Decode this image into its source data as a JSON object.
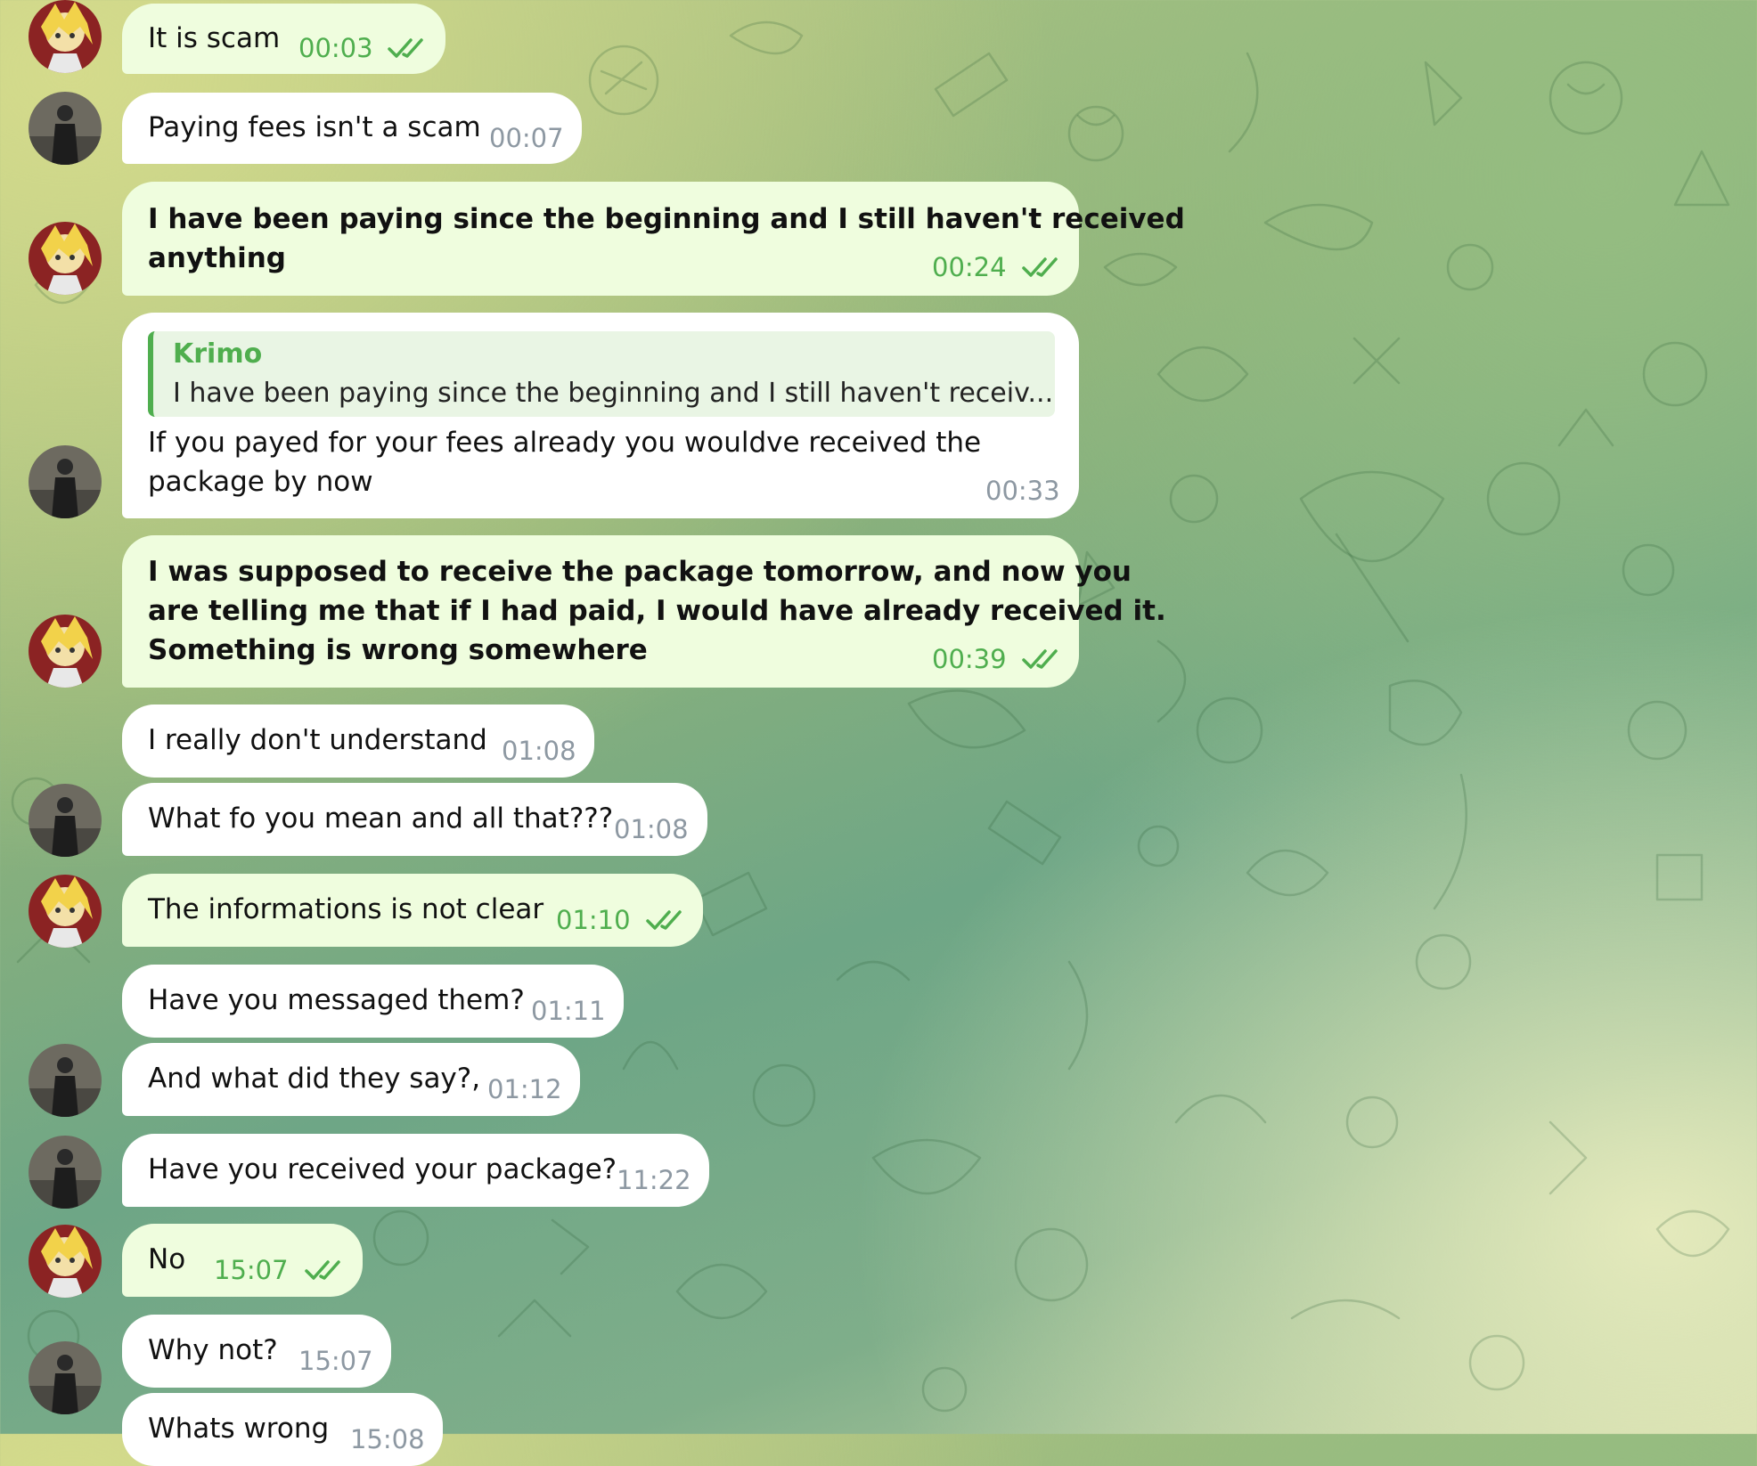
{
  "chat": {
    "messages": [
      {
        "sender": "me",
        "text": "It is scam",
        "time": "00:03",
        "status": "read"
      },
      {
        "sender": "them",
        "text": "Paying fees isn't a scam",
        "time": "00:07"
      },
      {
        "sender": "me",
        "text": "I have been paying since the beginning and I still haven't received anything",
        "line1": "I have been paying since the beginning and I still haven't received",
        "line2": "anything",
        "time": "00:24",
        "status": "read"
      },
      {
        "sender": "them",
        "reply_name": "Krimo",
        "reply_text": "I have been paying since the beginning and I still haven't receiv...",
        "line1": "If you payed for your fees already you wouldve received the",
        "line2": "package by now",
        "time": "00:33"
      },
      {
        "sender": "me",
        "line1": "I was supposed to receive the package tomorrow, and now you",
        "line2": "are telling me that if I had paid, I would have already received it.",
        "line3": "Something is wrong somewhere",
        "time": "00:39",
        "status": "read"
      },
      {
        "sender": "them",
        "text": "I really don't understand",
        "time": "01:08"
      },
      {
        "sender": "them",
        "text": "What fo you mean and all that???",
        "time": "01:08"
      },
      {
        "sender": "me",
        "text": "The informations is not clear",
        "time": "01:10",
        "status": "read"
      },
      {
        "sender": "them",
        "text": "Have you messaged them?",
        "time": "01:11"
      },
      {
        "sender": "them",
        "text": "And what did they say?,",
        "time": "01:12"
      },
      {
        "sender": "them",
        "text": "Have you received your package?",
        "time": "11:22"
      },
      {
        "sender": "me",
        "text": "No",
        "time": "15:07",
        "status": "read"
      },
      {
        "sender": "them",
        "text": "Why not?",
        "time": "15:07"
      },
      {
        "sender": "them",
        "text": "Whats wrong",
        "time": "15:08"
      }
    ]
  },
  "colors": {
    "incoming_bubble": "#ffffff",
    "outgoing_bubble": "#effdde",
    "outgoing_meta": "#4fae4e",
    "incoming_meta": "#8d98a2"
  },
  "icons": {
    "read_status": "double-check-icon",
    "my_avatar": "blond-anime-character-avatar",
    "their_avatar": "man-in-dark-coat-avatar"
  }
}
